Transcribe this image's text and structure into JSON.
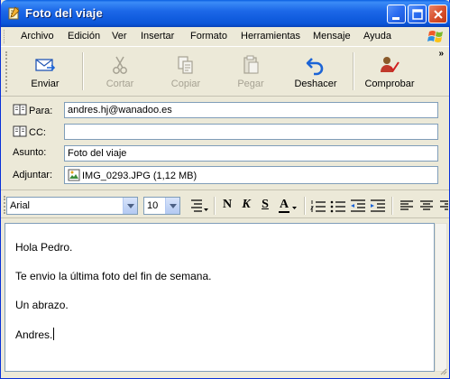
{
  "window": {
    "title": "Foto del viaje"
  },
  "menu": {
    "items": [
      "Archivo",
      "Edición",
      "Ver",
      "Insertar",
      "Formato",
      "Herramientas",
      "Mensaje",
      "Ayuda"
    ]
  },
  "toolbar": {
    "send_label": "Enviar",
    "cut_label": "Cortar",
    "copy_label": "Copiar",
    "paste_label": "Pegar",
    "undo_label": "Deshacer",
    "check_label": "Comprobar",
    "overflow_glyph": "»"
  },
  "fields": {
    "to_label": "Para:",
    "to_value": "andres.hj@wanadoo.es",
    "cc_label": "CC:",
    "cc_value": "",
    "subject_label": "Asunto:",
    "subject_value": "Foto del viaje",
    "attach_label": "Adjuntar:",
    "attach_value": "IMG_0293.JPG (1,12 MB)"
  },
  "format": {
    "font": "Arial",
    "size": "10",
    "bold": "N",
    "italic": "K",
    "underline": "S",
    "font_color": "A"
  },
  "body": {
    "lines": [
      "Hola Pedro.",
      "Te envio la última foto del fin de semana.",
      "Un abrazo.",
      "Andres."
    ]
  },
  "colors": {
    "titlebar": "#0A55D8",
    "chrome": "#ECE9D8",
    "field_border": "#7F9DB9",
    "undo_icon": "#1C64D6"
  },
  "icons": {
    "title": "compose-mail-icon",
    "send": "send-envelope-icon",
    "cut": "scissors-icon",
    "copy": "copy-icon",
    "paste": "paste-icon",
    "undo": "undo-arrow-icon",
    "check": "spellcheck-icon",
    "address_book": "address-book-icon",
    "attachment": "image-file-icon"
  }
}
